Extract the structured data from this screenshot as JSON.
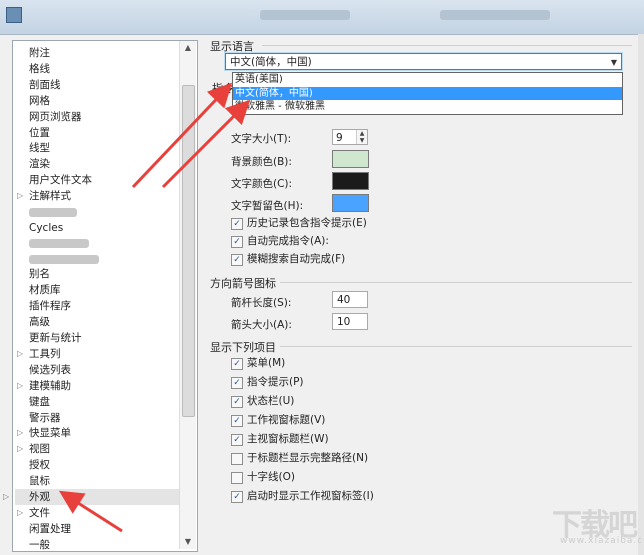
{
  "window": {
    "title": ""
  },
  "tree": {
    "items": [
      {
        "label": "附注",
        "expander": false
      },
      {
        "label": "格线",
        "expander": false
      },
      {
        "label": "剖面线",
        "expander": false
      },
      {
        "label": "网格",
        "expander": false
      },
      {
        "label": "网页浏览器",
        "expander": false
      },
      {
        "label": "位置",
        "expander": false
      },
      {
        "label": "线型",
        "expander": false
      },
      {
        "label": "渲染",
        "expander": false
      },
      {
        "label": "用户文件文本",
        "expander": false
      },
      {
        "label": "注解样式",
        "expander": true
      },
      {
        "label": "",
        "expander": false
      },
      {
        "label": "Cycles",
        "expander": false
      },
      {
        "label": "",
        "expander": false
      },
      {
        "label": "",
        "expander": false
      },
      {
        "label": "别名",
        "expander": false
      },
      {
        "label": "材质库",
        "expander": false
      },
      {
        "label": "插件程序",
        "expander": false
      },
      {
        "label": "高级",
        "expander": false
      },
      {
        "label": "更新与统计",
        "expander": false
      },
      {
        "label": "工具列",
        "expander": true
      },
      {
        "label": "候选列表",
        "expander": false
      },
      {
        "label": "建模辅助",
        "expander": true
      },
      {
        "label": "键盘",
        "expander": false
      },
      {
        "label": "警示器",
        "expander": false
      },
      {
        "label": "快显菜单",
        "expander": true
      },
      {
        "label": "视图",
        "expander": true
      },
      {
        "label": "授权",
        "expander": false
      },
      {
        "label": "鼠标",
        "expander": false
      },
      {
        "label": "外观",
        "expander": true,
        "selected": true
      },
      {
        "label": "文件",
        "expander": true
      },
      {
        "label": "闲置处理",
        "expander": false
      },
      {
        "label": "一般",
        "expander": false
      }
    ]
  },
  "language": {
    "group_label": "显示语言",
    "selected": "中文(简体，中国)",
    "options": [
      "英语(美国)",
      "中文(简体，中国)",
      "微软雅黑 - 微软雅黑"
    ]
  },
  "command_group": {
    "label": "指令",
    "font_size_label": "文字大小(T):",
    "font_size_value": "9",
    "bg_color_label": "背景颜色(B):",
    "bg_color": "#cfe6cf",
    "text_color_label": "文字颜色(C):",
    "text_color": "#1b1b1b",
    "text_hover_label": "文字暂留色(H):",
    "text_hover_color": "#4aa3ff",
    "checks": [
      {
        "label": "历史记录包含指令提示(E)",
        "checked": true
      },
      {
        "label": "自动完成指令(A):",
        "checked": true
      },
      {
        "label": "模糊搜索自动完成(F)",
        "checked": true
      }
    ]
  },
  "arrow_group": {
    "label": "方向箭号图标",
    "shaft_label": "箭杆长度(S):",
    "shaft_value": "40",
    "head_label": "箭头大小(A):",
    "head_value": "10"
  },
  "show_group": {
    "label": "显示下列项目",
    "checks": [
      {
        "label": "菜单(M)",
        "checked": true
      },
      {
        "label": "指令提示(P)",
        "checked": true
      },
      {
        "label": "状态栏(U)",
        "checked": true
      },
      {
        "label": "工作视窗标题(V)",
        "checked": true
      },
      {
        "label": "主视窗标题栏(W)",
        "checked": true
      },
      {
        "label": "于标题栏显示完整路径(N)",
        "checked": false
      },
      {
        "label": "十字线(O)",
        "checked": false
      },
      {
        "label": "启动时显示工作视窗标签(I)",
        "checked": true
      }
    ]
  },
  "annotation_color": "#e8403a",
  "watermark": {
    "text": "下载吧",
    "sub": "www.xiazaiba.com"
  }
}
